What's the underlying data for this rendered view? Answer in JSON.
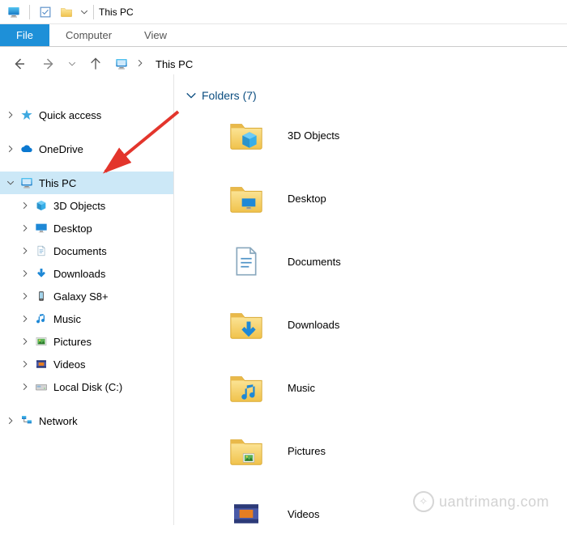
{
  "window": {
    "title": "This PC"
  },
  "ribbon": {
    "tabs": [
      {
        "label": "File",
        "active": true
      },
      {
        "label": "Computer",
        "active": false
      },
      {
        "label": "View",
        "active": false
      }
    ]
  },
  "address": {
    "location": "This PC"
  },
  "tree": {
    "quick_access": {
      "label": "Quick access"
    },
    "onedrive": {
      "label": "OneDrive"
    },
    "this_pc": {
      "label": "This PC",
      "children": [
        {
          "label": "3D Objects"
        },
        {
          "label": "Desktop"
        },
        {
          "label": "Documents"
        },
        {
          "label": "Downloads"
        },
        {
          "label": "Galaxy S8+"
        },
        {
          "label": "Music"
        },
        {
          "label": "Pictures"
        },
        {
          "label": "Videos"
        },
        {
          "label": "Local Disk (C:)"
        }
      ]
    },
    "network": {
      "label": "Network"
    }
  },
  "main": {
    "section_title": "Folders (7)",
    "folders": [
      {
        "label": "3D Objects"
      },
      {
        "label": "Desktop"
      },
      {
        "label": "Documents"
      },
      {
        "label": "Downloads"
      },
      {
        "label": "Music"
      },
      {
        "label": "Pictures"
      },
      {
        "label": "Videos"
      }
    ]
  },
  "watermark": "uantrimang.com"
}
